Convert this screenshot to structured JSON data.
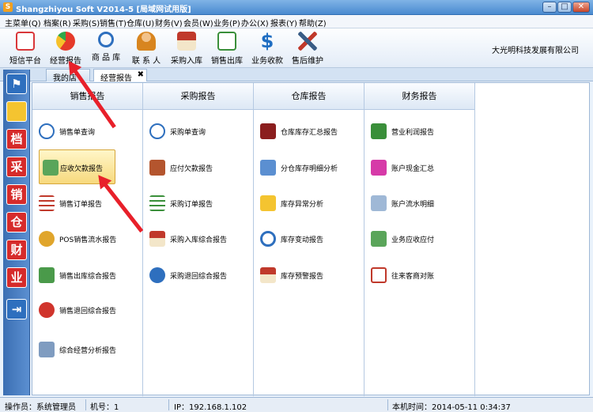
{
  "window": {
    "title": "Shangzhiyou Soft V2014-5 [局域网试用版]",
    "app_icon": "S",
    "btn_min": "–",
    "btn_max": "□",
    "btn_close": "✕"
  },
  "menu": [
    "主菜单(Q)",
    "档案(R)",
    "采购(S)",
    "销售(T)",
    "仓库(U)",
    "财务(V)",
    "会员(W)",
    "业务(P)",
    "办公(X)",
    "报表(Y)",
    "帮助(Z)"
  ],
  "toolbar": {
    "items": [
      {
        "label": "短信平台",
        "icon": "envelope-icon",
        "color": "#d9373a"
      },
      {
        "label": "经营报告",
        "icon": "pie-chart-icon",
        "color": "#e53a2a"
      },
      {
        "label": "商 品 库",
        "icon": "magnifier-icon",
        "color": "#2e6fbe"
      },
      {
        "label": "联 系 人",
        "icon": "person-icon",
        "color": "#d8851f"
      },
      {
        "label": "采购入库",
        "icon": "house-icon",
        "color": "#c0392b"
      },
      {
        "label": "销售出库",
        "icon": "document-icon",
        "color": "#3a8f3a"
      },
      {
        "label": "业务收款",
        "icon": "dollar-icon",
        "color": "#1e6dc2"
      },
      {
        "label": "售后维护",
        "icon": "tools-icon",
        "color": "#3a5d86"
      }
    ],
    "company": "大光明科技发展有限公司"
  },
  "tabs": [
    {
      "label": "我的店铺"
    },
    {
      "label": "经营报告",
      "close": "✖"
    }
  ],
  "leftbar": [
    {
      "icon": "flag-icon",
      "text": ""
    },
    {
      "icon": "lightbulb-icon",
      "text": ""
    },
    {
      "icon": "archive-icon",
      "text": "档"
    },
    {
      "icon": "purchase-icon",
      "text": "采"
    },
    {
      "icon": "sales-icon",
      "text": "销"
    },
    {
      "icon": "warehouse-icon",
      "text": "仓"
    },
    {
      "icon": "finance-icon",
      "text": "财"
    },
    {
      "icon": "business-icon",
      "text": "业"
    },
    {
      "icon": "exit-icon",
      "text": ""
    }
  ],
  "columns": [
    {
      "header": "销售报告",
      "items": [
        "销售单查询",
        "应收欠款报告",
        "销售订单报告",
        "POS销售流水报告",
        "销售出库综合报告",
        "销售退回综合报告",
        "综合经营分析报告"
      ]
    },
    {
      "header": "采购报告",
      "items": [
        "采购单查询",
        "应付欠款报告",
        "采购订单报告",
        "采购入库综合报告",
        "采购退回综合报告"
      ]
    },
    {
      "header": "仓库报告",
      "items": [
        "仓库库存汇总报告",
        "分仓库存明细分析",
        "库存异常分析",
        "库存变动报告",
        "库存预警报告"
      ]
    },
    {
      "header": "财务报告",
      "items": [
        "营业利润报告",
        "账户现金汇总",
        "账户流水明细",
        "业务应收应付",
        "往来客商对账"
      ]
    }
  ],
  "status": {
    "operator": "操作员：系统管理员",
    "machine": "机号：1",
    "ip": "IP：192.168.1.102",
    "time": "本机时间：2014-05-11 0:34:37"
  }
}
